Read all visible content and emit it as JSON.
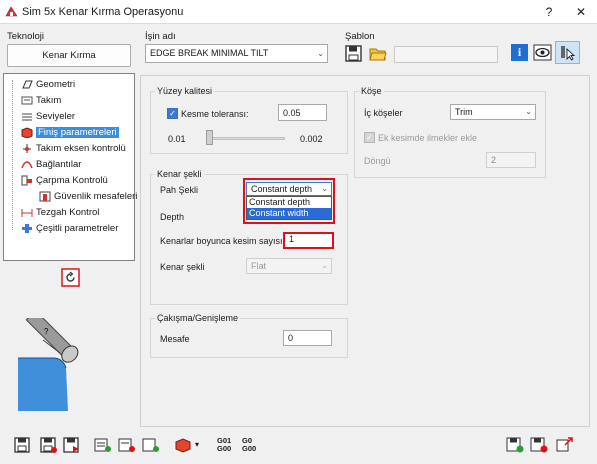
{
  "window": {
    "title": "Sim 5x Kenar Kırma Operasyonu",
    "help_label": "?",
    "close_label": "✕"
  },
  "teknoloji": {
    "label": "Teknoloji",
    "button": "Kenar Kırma"
  },
  "isin_adi": {
    "label": "İşin adı",
    "value": "EDGE BREAK MINIMAL TILT"
  },
  "sablon": {
    "label": "Şablon"
  },
  "tree": {
    "items": [
      {
        "label": "Geometri",
        "icon": "geometry-icon"
      },
      {
        "label": "Takım",
        "icon": "tool-icon"
      },
      {
        "label": "Seviyeler",
        "icon": "levels-icon"
      },
      {
        "label": "Finiş parametreleri",
        "icon": "finish-params-icon",
        "selected": true
      },
      {
        "label": "Takım eksen kontrolü",
        "icon": "axis-control-icon"
      },
      {
        "label": "Bağlantılar",
        "icon": "links-icon"
      },
      {
        "label": "Çarpma Kontrolü",
        "icon": "collision-icon"
      },
      {
        "label": "Güvenlik mesafeleri",
        "icon": "safety-icon"
      },
      {
        "label": "Tezgah Kontrol",
        "icon": "machine-icon"
      },
      {
        "label": "Çeşitli parametreler",
        "icon": "misc-params-icon"
      }
    ]
  },
  "yuzey": {
    "title": "Yüzey kalitesi",
    "tolerance_label": "Kesme toleransı:",
    "tolerance_value": "0.05",
    "slider_min": "0.01",
    "slider_max": "0.002",
    "slider_level": 0.02
  },
  "kenar": {
    "title": "Kenar şekli",
    "pah_label": "Pah Şekli",
    "pah_value": "Constant depth",
    "pah_options": [
      "Constant depth",
      "Constant width"
    ],
    "pah_highlighted": "Constant width",
    "depth_label": "Depth",
    "passes_label": "Kenarlar boyunca kesim sayısı",
    "passes_value": "1",
    "shape_label": "Kenar şekli",
    "shape_value": "Flat"
  },
  "kose": {
    "title": "Köşe",
    "inner_label": "İç köşeler",
    "inner_value": "Trim",
    "extra_label": "Ek kesimde ilmekler ekle",
    "loop_label": "Döngü",
    "loop_value": "2"
  },
  "cakisma": {
    "title": "Çakışma/Genişleme",
    "mesafe_label": "Mesafe",
    "mesafe_value": "0"
  },
  "toolbar": {
    "g01_top": "G01",
    "g01_bottom": "G00",
    "g0_top": "G0",
    "g0_bottom": "G00"
  },
  "colors": {
    "accent": "#3b78d6",
    "selection": "#3b8de0",
    "highlight_red": "#e0101b"
  }
}
